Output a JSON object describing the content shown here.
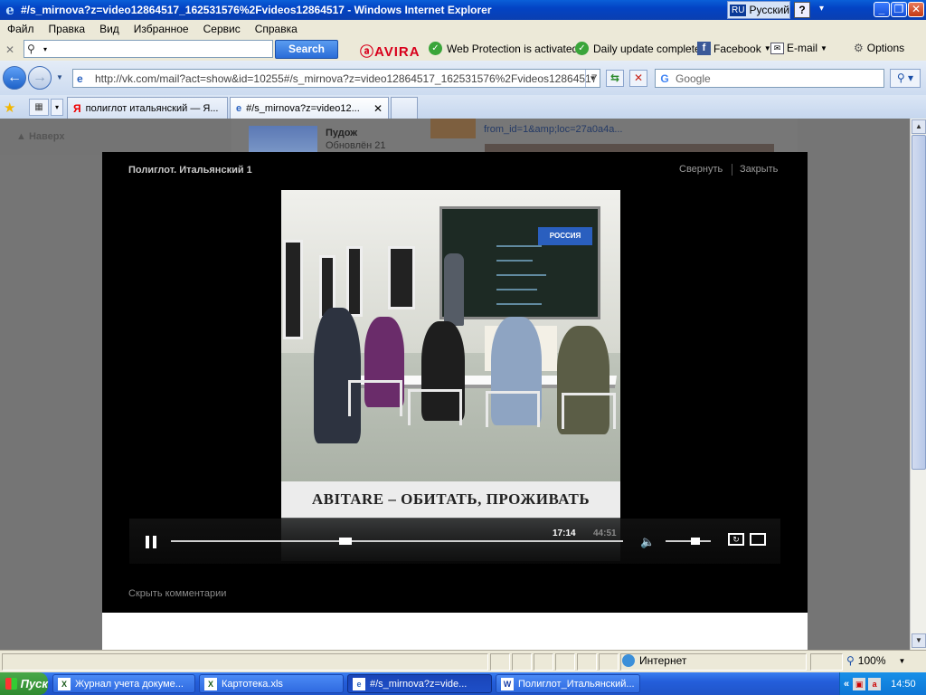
{
  "window": {
    "title": "#/s_mirnova?z=video12864517_162531576%2Fvideos12864517 - Windows Internet Explorer",
    "lang_code": "RU",
    "lang_name": "Русский"
  },
  "menu": [
    "Файл",
    "Правка",
    "Вид",
    "Избранное",
    "Сервис",
    "Справка"
  ],
  "toolbar": {
    "search_value": "",
    "search_button": "Search",
    "avira": "AVIRA",
    "web_protection": "Web Protection is activated",
    "daily_update": "Daily update complete",
    "facebook": "Facebook",
    "email": "E-mail",
    "options": "Options"
  },
  "address": {
    "url": "http://vk.com/mail?act=show&id=10255#/s_mirnova?z=video12864517_162531576%2Fvideos12864517",
    "search_placeholder": "Google"
  },
  "tabs": [
    {
      "label": "полиглот итальянский — Я..."
    },
    {
      "label": "#/s_mirnova?z=video12..."
    }
  ],
  "background_page": {
    "back_link": "Наверх",
    "name": "Пудож",
    "updated": "Обновлён 21",
    "link_text": "from_id=1&amp;loc=27a0a4a..."
  },
  "player": {
    "title": "Полиглот. Итальянский 1",
    "minimize": "Свернуть",
    "close": "Закрыть",
    "caption": "ABITARE – ОБИТАТЬ, ПРОЖИВАТЬ",
    "channel_logo": "РОССИЯ",
    "current_time": "17:14",
    "total_time": "44:51",
    "progress": 0.385,
    "volume": 0.65,
    "hide_comments": "Скрыть комментарии"
  },
  "statusbar": {
    "zone": "Интернет",
    "zoom": "100%"
  },
  "taskbar": {
    "start": "Пуск",
    "tasks": [
      {
        "label": "Журнал учета докуме..."
      },
      {
        "label": "Картотека.xls"
      },
      {
        "label": "#/s_mirnova?z=vide..."
      },
      {
        "label": "Полиглот_Итальянский..."
      }
    ],
    "clock": "14:50"
  }
}
